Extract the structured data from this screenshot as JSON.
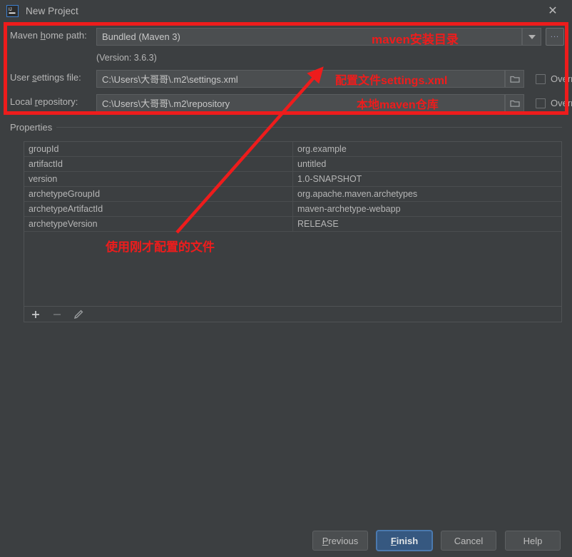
{
  "window": {
    "title": "New Project",
    "app_icon": "intellij-idea-icon",
    "close_label": "✕"
  },
  "form": {
    "maven_home": {
      "label_pre": "Maven ",
      "label_accel": "h",
      "label_post": "ome path:",
      "value": "Bundled (Maven 3)",
      "dropdown_icon": "chevron-down-icon",
      "browse_label": "..."
    },
    "version_note": "(Version: 3.6.3)",
    "user_settings": {
      "label_pre": "User ",
      "label_accel": "s",
      "label_post": "ettings file:",
      "value": "C:\\Users\\大哥哥\\.m2\\settings.xml",
      "folder_icon": "folder-icon",
      "override_label": "Override",
      "override_checked": false
    },
    "local_repository": {
      "label_pre": "Local ",
      "label_accel": "r",
      "label_post": "epository:",
      "value": "C:\\Users\\大哥哥\\.m2\\repository",
      "folder_icon": "folder-icon",
      "override_label": "Override",
      "override_checked": false
    }
  },
  "properties": {
    "title": "Properties",
    "rows": [
      {
        "key": "groupId",
        "value": "org.example"
      },
      {
        "key": "artifactId",
        "value": "untitled"
      },
      {
        "key": "version",
        "value": "1.0-SNAPSHOT"
      },
      {
        "key": "archetypeGroupId",
        "value": "org.apache.maven.archetypes"
      },
      {
        "key": "archetypeArtifactId",
        "value": "maven-archetype-webapp"
      },
      {
        "key": "archetypeVersion",
        "value": "RELEASE"
      }
    ],
    "toolbar": {
      "add_icon": "plus-icon",
      "remove_icon": "minus-icon",
      "edit_icon": "pencil-icon"
    }
  },
  "buttons": {
    "previous": {
      "pre": "",
      "accel": "P",
      "post": "revious"
    },
    "finish": {
      "pre": "",
      "accel": "F",
      "post": "inish"
    },
    "cancel": {
      "label": "Cancel"
    },
    "help": {
      "label": "Help"
    }
  },
  "annotations": {
    "accent_color": "#ee1c1c",
    "maven_home_note": "maven安装目录",
    "settings_note": "配置文件settings.xml",
    "repository_note": "本地maven仓库",
    "use_configured_file_note": "使用刚才配置的文件"
  }
}
